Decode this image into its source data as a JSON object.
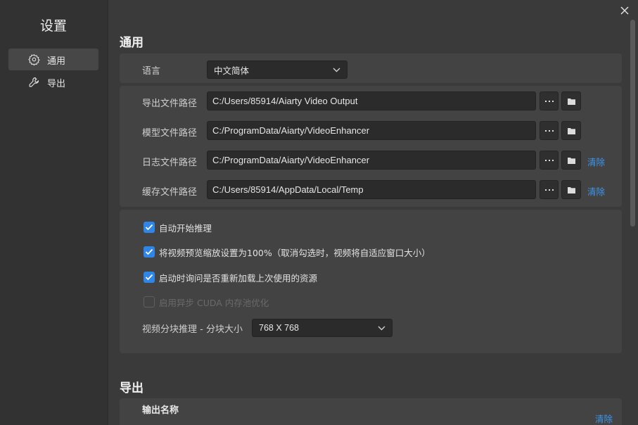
{
  "sidebar": {
    "title": "设置",
    "items": [
      {
        "label": "通用",
        "icon": "gear-icon",
        "active": true
      },
      {
        "label": "导出",
        "icon": "wrench-icon",
        "active": false
      }
    ]
  },
  "general": {
    "section_title": "通用",
    "language": {
      "label": "语言",
      "value": "中文简体"
    },
    "paths": [
      {
        "label": "导出文件路径",
        "value": "C:/Users/85914/Aiarty Video Output",
        "clear": ""
      },
      {
        "label": "模型文件路径",
        "value": "C:/ProgramData/Aiarty/VideoEnhancer",
        "clear": ""
      },
      {
        "label": "日志文件路径",
        "value": "C:/ProgramData/Aiarty/VideoEnhancer",
        "clear": "清除"
      },
      {
        "label": "缓存文件路径",
        "value": "C:/Users/85914/AppData/Local/Temp",
        "clear": "清除"
      }
    ],
    "checkboxes": [
      {
        "label": "自动开始推理",
        "checked": true,
        "disabled": false
      },
      {
        "label": "将视频预览缩放设置为100%（取消勾选时，视频将自适应窗口大小）",
        "checked": true,
        "disabled": false
      },
      {
        "label": "启动时询问是否重新加载上次使用的资源",
        "checked": true,
        "disabled": false
      },
      {
        "label": "启用异步 CUDA 内存池优化",
        "checked": false,
        "disabled": true
      }
    ],
    "tile": {
      "label": "视频分块推理 - 分块大小",
      "value": "768 X 768"
    }
  },
  "export": {
    "section_title": "导出",
    "output_name_label": "输出名称",
    "clear_label": "清除"
  },
  "colors": {
    "accent": "#2f86e6",
    "link": "#3c96ee",
    "background": "#3a3a3a",
    "sidebar": "#323232",
    "card": "#434343"
  }
}
